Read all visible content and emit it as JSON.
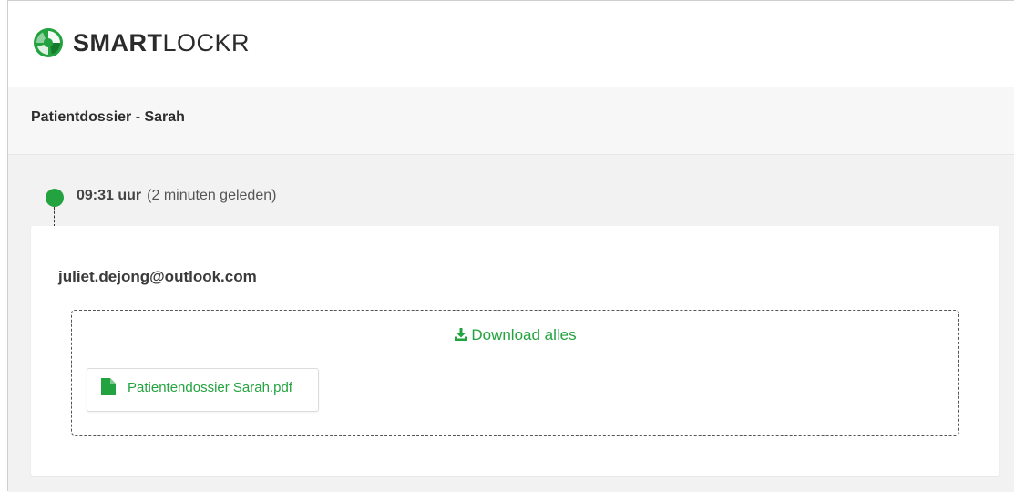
{
  "brand": {
    "name_bold": "SMART",
    "name_light": "LOCKR",
    "accent_color": "#23a33f"
  },
  "page": {
    "title": "Patientdossier - Sarah"
  },
  "timeline": {
    "time": "09:31 uur",
    "relative": "(2 minuten geleden)"
  },
  "message": {
    "sender": "juliet.dejong@outlook.com",
    "download_all_label": "Download alles",
    "download_icon": "download-icon",
    "files": [
      {
        "name": "Patientendossier Sarah.pdf",
        "icon": "file-icon"
      }
    ]
  }
}
